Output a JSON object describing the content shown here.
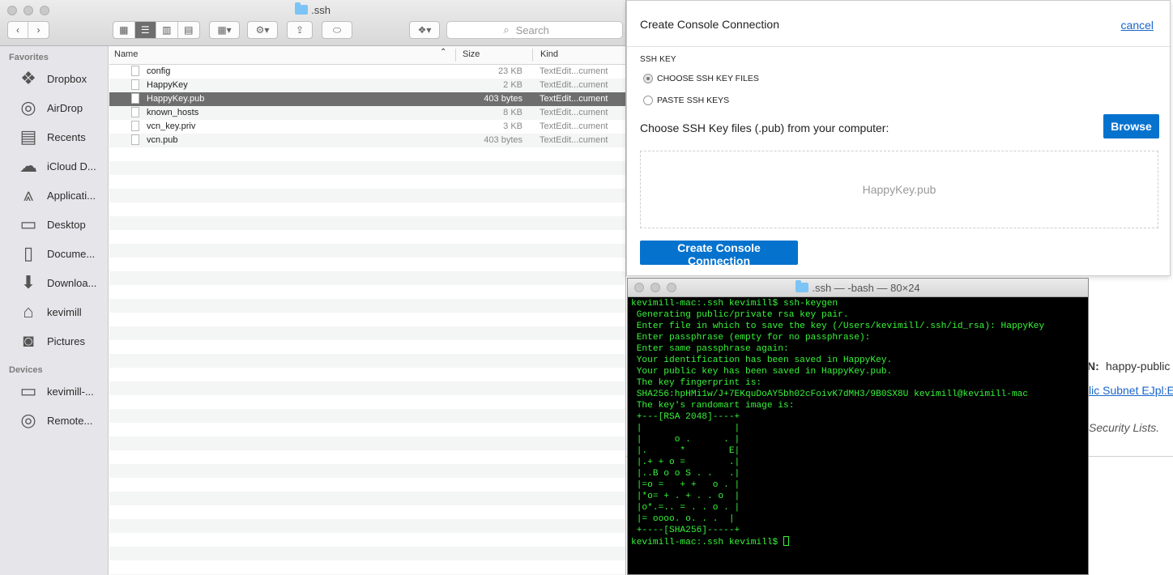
{
  "finder": {
    "title": ".ssh",
    "search_placeholder": "Search",
    "sidebar": {
      "favorites_header": "Favorites",
      "favorites": [
        {
          "label": "Dropbox",
          "icon": "dropbox-icon"
        },
        {
          "label": "AirDrop",
          "icon": "airdrop-icon"
        },
        {
          "label": "Recents",
          "icon": "recents-icon"
        },
        {
          "label": "iCloud D...",
          "icon": "icloud-icon"
        },
        {
          "label": "Applicati...",
          "icon": "applications-icon"
        },
        {
          "label": "Desktop",
          "icon": "desktop-icon"
        },
        {
          "label": "Docume...",
          "icon": "documents-icon"
        },
        {
          "label": "Downloa...",
          "icon": "downloads-icon"
        },
        {
          "label": "kevimill",
          "icon": "home-icon"
        },
        {
          "label": "Pictures",
          "icon": "pictures-icon"
        }
      ],
      "devices_header": "Devices",
      "devices": [
        {
          "label": "kevimill-...",
          "icon": "laptop-icon"
        },
        {
          "label": "Remote...",
          "icon": "remote-disc-icon"
        }
      ]
    },
    "columns": {
      "name": "Name",
      "size": "Size",
      "kind": "Kind"
    },
    "files": [
      {
        "name": "config",
        "size": "23 KB",
        "kind": "TextEdit...cument",
        "selected": false
      },
      {
        "name": "HappyKey",
        "size": "2 KB",
        "kind": "TextEdit...cument",
        "selected": false
      },
      {
        "name": "HappyKey.pub",
        "size": "403 bytes",
        "kind": "TextEdit...cument",
        "selected": true
      },
      {
        "name": "known_hosts",
        "size": "8 KB",
        "kind": "TextEdit...cument",
        "selected": false
      },
      {
        "name": "vcn_key.priv",
        "size": "3 KB",
        "kind": "TextEdit...cument",
        "selected": false
      },
      {
        "name": "vcn.pub",
        "size": "403 bytes",
        "kind": "TextEdit...cument",
        "selected": false
      }
    ]
  },
  "dialog": {
    "title": "Create Console Connection",
    "cancel_label": "cancel",
    "ssh_key_label": "SSH KEY",
    "option_choose": "CHOOSE SSH KEY FILES",
    "option_paste": "PASTE SSH KEYS",
    "choose_text": "Choose SSH Key files (.pub) from your computer:",
    "browse_label": "Browse",
    "dropped_file": "HappyKey.pub",
    "create_label": "Create Console Connection"
  },
  "terminal": {
    "title": ".ssh — -bash — 80×24",
    "lines": [
      "kevimill-mac:.ssh kevimill$ ssh-keygen",
      " Generating public/private rsa key pair.",
      " Enter file in which to save the key (/Users/kevimill/.ssh/id_rsa): HappyKey",
      " Enter passphrase (empty for no passphrase):",
      " Enter same passphrase again:",
      " Your identification has been saved in HappyKey.",
      " Your public key has been saved in HappyKey.pub.",
      " The key fingerprint is:",
      " SHA256:hpHMi1w/J+7EKquDoAY5bh02cFoivK7dMH3/9B0SX8U kevimill@kevimill-mac",
      " The key's randomart image is:",
      " +---[RSA 2048]----+",
      " |                 |",
      " |      o .      . |",
      " |.      *        E|",
      " |.+ + o =        .|",
      " |..B o o S . .   .|",
      " |=o =   + +   o . |",
      " |*o= + . + . . o  |",
      " |o*.=.. = . . o . |",
      " |= oooo. o. . .  |",
      " +----[SHA256]-----+",
      "kevimill-mac:.ssh kevimill$ "
    ]
  },
  "background": {
    "label_fragment": "N:",
    "value_fragment": "happy-public",
    "link_fragment": "lic Subnet EJpl:E",
    "italic_fragment": "Security Lists."
  }
}
